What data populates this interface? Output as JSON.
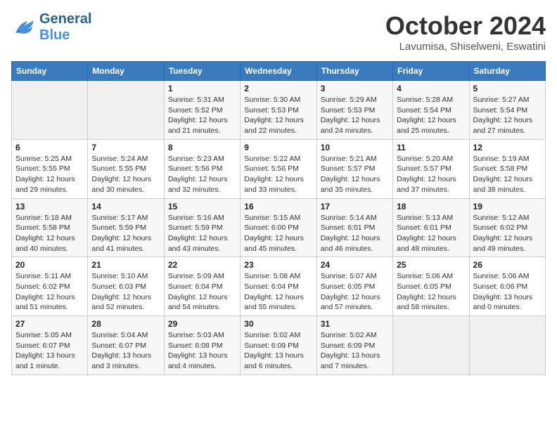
{
  "header": {
    "logo_line1": "General",
    "logo_line2": "Blue",
    "month_title": "October 2024",
    "subtitle": "Lavumisa, Shiselweni, Eswatini"
  },
  "weekdays": [
    "Sunday",
    "Monday",
    "Tuesday",
    "Wednesday",
    "Thursday",
    "Friday",
    "Saturday"
  ],
  "weeks": [
    [
      {
        "day": "",
        "sunrise": "",
        "sunset": "",
        "daylight": ""
      },
      {
        "day": "",
        "sunrise": "",
        "sunset": "",
        "daylight": ""
      },
      {
        "day": "1",
        "sunrise": "Sunrise: 5:31 AM",
        "sunset": "Sunset: 5:52 PM",
        "daylight": "Daylight: 12 hours and 21 minutes."
      },
      {
        "day": "2",
        "sunrise": "Sunrise: 5:30 AM",
        "sunset": "Sunset: 5:53 PM",
        "daylight": "Daylight: 12 hours and 22 minutes."
      },
      {
        "day": "3",
        "sunrise": "Sunrise: 5:29 AM",
        "sunset": "Sunset: 5:53 PM",
        "daylight": "Daylight: 12 hours and 24 minutes."
      },
      {
        "day": "4",
        "sunrise": "Sunrise: 5:28 AM",
        "sunset": "Sunset: 5:54 PM",
        "daylight": "Daylight: 12 hours and 25 minutes."
      },
      {
        "day": "5",
        "sunrise": "Sunrise: 5:27 AM",
        "sunset": "Sunset: 5:54 PM",
        "daylight": "Daylight: 12 hours and 27 minutes."
      }
    ],
    [
      {
        "day": "6",
        "sunrise": "Sunrise: 5:25 AM",
        "sunset": "Sunset: 5:55 PM",
        "daylight": "Daylight: 12 hours and 29 minutes."
      },
      {
        "day": "7",
        "sunrise": "Sunrise: 5:24 AM",
        "sunset": "Sunset: 5:55 PM",
        "daylight": "Daylight: 12 hours and 30 minutes."
      },
      {
        "day": "8",
        "sunrise": "Sunrise: 5:23 AM",
        "sunset": "Sunset: 5:56 PM",
        "daylight": "Daylight: 12 hours and 32 minutes."
      },
      {
        "day": "9",
        "sunrise": "Sunrise: 5:22 AM",
        "sunset": "Sunset: 5:56 PM",
        "daylight": "Daylight: 12 hours and 33 minutes."
      },
      {
        "day": "10",
        "sunrise": "Sunrise: 5:21 AM",
        "sunset": "Sunset: 5:57 PM",
        "daylight": "Daylight: 12 hours and 35 minutes."
      },
      {
        "day": "11",
        "sunrise": "Sunrise: 5:20 AM",
        "sunset": "Sunset: 5:57 PM",
        "daylight": "Daylight: 12 hours and 37 minutes."
      },
      {
        "day": "12",
        "sunrise": "Sunrise: 5:19 AM",
        "sunset": "Sunset: 5:58 PM",
        "daylight": "Daylight: 12 hours and 38 minutes."
      }
    ],
    [
      {
        "day": "13",
        "sunrise": "Sunrise: 5:18 AM",
        "sunset": "Sunset: 5:58 PM",
        "daylight": "Daylight: 12 hours and 40 minutes."
      },
      {
        "day": "14",
        "sunrise": "Sunrise: 5:17 AM",
        "sunset": "Sunset: 5:59 PM",
        "daylight": "Daylight: 12 hours and 41 minutes."
      },
      {
        "day": "15",
        "sunrise": "Sunrise: 5:16 AM",
        "sunset": "Sunset: 5:59 PM",
        "daylight": "Daylight: 12 hours and 43 minutes."
      },
      {
        "day": "16",
        "sunrise": "Sunrise: 5:15 AM",
        "sunset": "Sunset: 6:00 PM",
        "daylight": "Daylight: 12 hours and 45 minutes."
      },
      {
        "day": "17",
        "sunrise": "Sunrise: 5:14 AM",
        "sunset": "Sunset: 6:01 PM",
        "daylight": "Daylight: 12 hours and 46 minutes."
      },
      {
        "day": "18",
        "sunrise": "Sunrise: 5:13 AM",
        "sunset": "Sunset: 6:01 PM",
        "daylight": "Daylight: 12 hours and 48 minutes."
      },
      {
        "day": "19",
        "sunrise": "Sunrise: 5:12 AM",
        "sunset": "Sunset: 6:02 PM",
        "daylight": "Daylight: 12 hours and 49 minutes."
      }
    ],
    [
      {
        "day": "20",
        "sunrise": "Sunrise: 5:11 AM",
        "sunset": "Sunset: 6:02 PM",
        "daylight": "Daylight: 12 hours and 51 minutes."
      },
      {
        "day": "21",
        "sunrise": "Sunrise: 5:10 AM",
        "sunset": "Sunset: 6:03 PM",
        "daylight": "Daylight: 12 hours and 52 minutes."
      },
      {
        "day": "22",
        "sunrise": "Sunrise: 5:09 AM",
        "sunset": "Sunset: 6:04 PM",
        "daylight": "Daylight: 12 hours and 54 minutes."
      },
      {
        "day": "23",
        "sunrise": "Sunrise: 5:08 AM",
        "sunset": "Sunset: 6:04 PM",
        "daylight": "Daylight: 12 hours and 55 minutes."
      },
      {
        "day": "24",
        "sunrise": "Sunrise: 5:07 AM",
        "sunset": "Sunset: 6:05 PM",
        "daylight": "Daylight: 12 hours and 57 minutes."
      },
      {
        "day": "25",
        "sunrise": "Sunrise: 5:06 AM",
        "sunset": "Sunset: 6:05 PM",
        "daylight": "Daylight: 12 hours and 58 minutes."
      },
      {
        "day": "26",
        "sunrise": "Sunrise: 5:06 AM",
        "sunset": "Sunset: 6:06 PM",
        "daylight": "Daylight: 13 hours and 0 minutes."
      }
    ],
    [
      {
        "day": "27",
        "sunrise": "Sunrise: 5:05 AM",
        "sunset": "Sunset: 6:07 PM",
        "daylight": "Daylight: 13 hours and 1 minute."
      },
      {
        "day": "28",
        "sunrise": "Sunrise: 5:04 AM",
        "sunset": "Sunset: 6:07 PM",
        "daylight": "Daylight: 13 hours and 3 minutes."
      },
      {
        "day": "29",
        "sunrise": "Sunrise: 5:03 AM",
        "sunset": "Sunset: 6:08 PM",
        "daylight": "Daylight: 13 hours and 4 minutes."
      },
      {
        "day": "30",
        "sunrise": "Sunrise: 5:02 AM",
        "sunset": "Sunset: 6:09 PM",
        "daylight": "Daylight: 13 hours and 6 minutes."
      },
      {
        "day": "31",
        "sunrise": "Sunrise: 5:02 AM",
        "sunset": "Sunset: 6:09 PM",
        "daylight": "Daylight: 13 hours and 7 minutes."
      },
      {
        "day": "",
        "sunrise": "",
        "sunset": "",
        "daylight": ""
      },
      {
        "day": "",
        "sunrise": "",
        "sunset": "",
        "daylight": ""
      }
    ]
  ]
}
